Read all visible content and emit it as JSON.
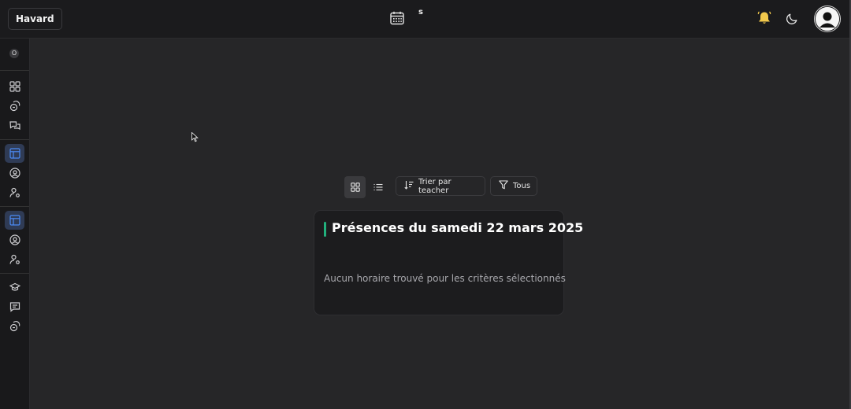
{
  "header": {
    "brand_label": "Havard",
    "center_letter": "s",
    "icons": [
      "calendar-icon",
      "bell-icon",
      "moon-icon",
      "user-avatar-icon"
    ],
    "bell_color": "#f2c94c"
  },
  "sidebar": {
    "top_badge": "O",
    "groups": [
      [
        "dashboard-icon",
        "finance-icon",
        "messages-icon"
      ],
      [
        "layout-icon",
        "user-circle-icon",
        "user-settings-icon"
      ],
      [
        "layout-icon",
        "user-circle-icon",
        "user-settings-icon"
      ],
      [
        "graduation-cap-icon",
        "chat-icon",
        "finance-icon"
      ]
    ],
    "active_color": "#3b82f6"
  },
  "toolbar": {
    "sort_label": "Trier par teacher",
    "filter_label": "Tous",
    "views": [
      "grid-view-icon",
      "list-view-icon"
    ],
    "selected_view": "grid-view-icon"
  },
  "card": {
    "title": "Présences du samedi 22 mars 2025",
    "empty_message": "Aucun horaire trouvé pour les critères sélectionnés",
    "accent_color": "#22b07d"
  }
}
